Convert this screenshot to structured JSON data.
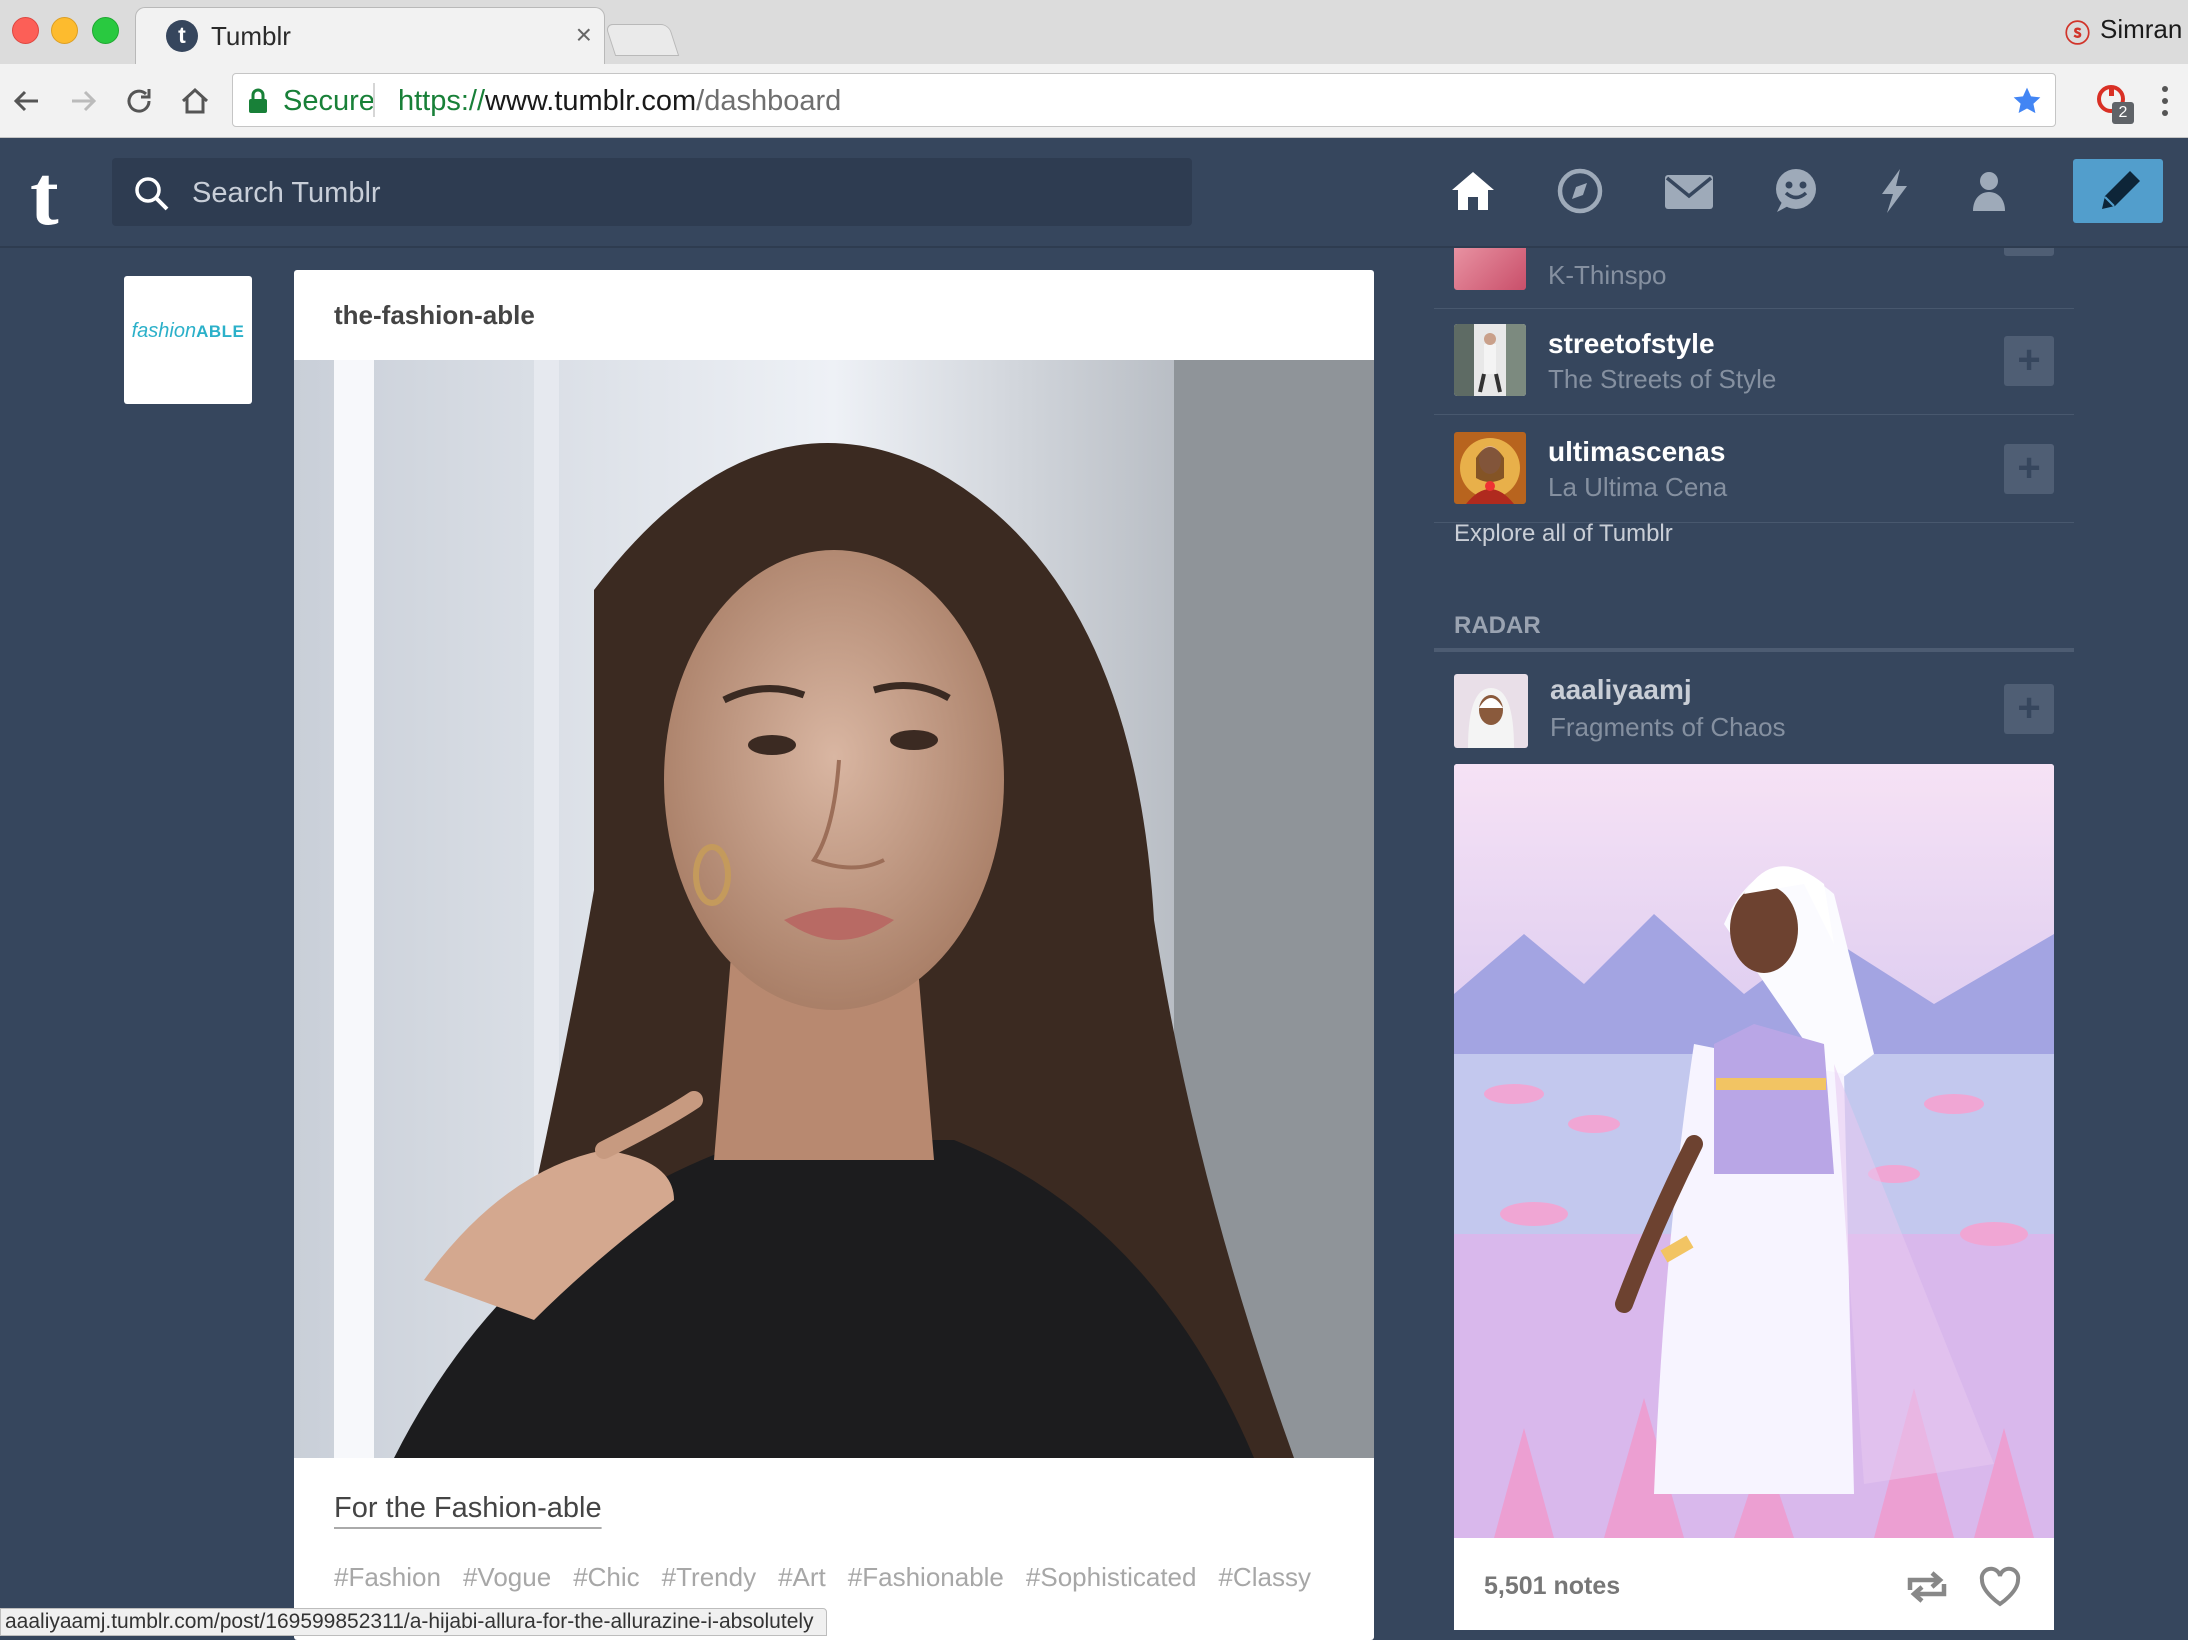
{
  "browser": {
    "tab_title": "Tumblr",
    "tab_close": "×",
    "profile_name": "Simran",
    "secure_label": "Secure",
    "url_scheme": "https://",
    "url_host": "www.tumblr.com",
    "url_path": "/dashboard",
    "extension_badge": "2",
    "status_url": "aaaliyaamj.tumblr.com/post/169599852311/a-hijabi-allura-for-the-allurazine-i-absolutely"
  },
  "header": {
    "logo": "t",
    "search_placeholder": "Search Tumblr",
    "icons": [
      "home-icon",
      "explore-icon",
      "inbox-icon",
      "messaging-icon",
      "activity-icon",
      "account-icon",
      "compose-pencil-icon"
    ],
    "accent_color": "#529ecc",
    "background_color": "#36465d"
  },
  "post": {
    "avatar_text_script": "fashion",
    "avatar_text_bold": "ABLE",
    "blog_name": "the-fashion-able",
    "caption": "For the Fashion-able",
    "tags": [
      "#Fashion",
      "#Vogue",
      "#Chic",
      "#Trendy",
      "#Art",
      "#Fashionable",
      "#Sophisticated",
      "#Classy"
    ]
  },
  "sidebar": {
    "recommended": [
      {
        "name": "",
        "title": "K-Thinspo",
        "follow": "+"
      },
      {
        "name": "streetofstyle",
        "title": "The Streets of Style",
        "follow": "+"
      },
      {
        "name": "ultimascenas",
        "title": "La Ultima Cena",
        "follow": "+"
      }
    ],
    "explore_link": "Explore all of Tumblr",
    "radar": {
      "label": "RADAR",
      "name": "aaaliyaamj",
      "title": "Fragments of Chaos",
      "follow": "+",
      "notes": "5,501 notes"
    }
  }
}
